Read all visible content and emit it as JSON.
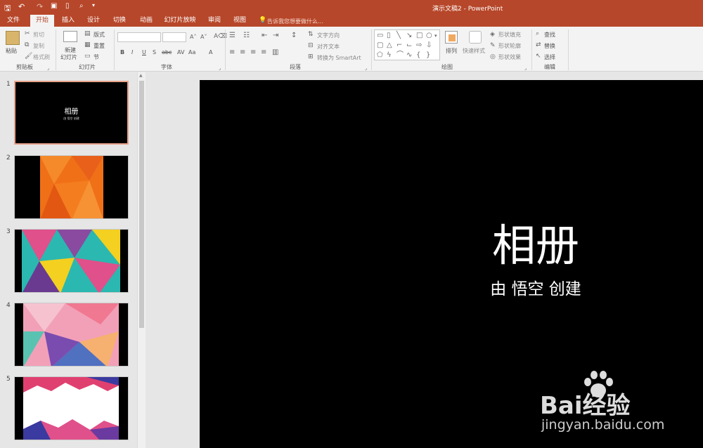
{
  "window": {
    "title": "演示文稿2 - PowerPoint",
    "qat": [
      "save-icon",
      "undo-icon",
      "redo-icon",
      "start-slideshow-icon",
      "new-icon",
      "customize-icon"
    ]
  },
  "tabs": [
    "文件",
    "开始",
    "插入",
    "设计",
    "切换",
    "动画",
    "幻灯片放映",
    "审阅",
    "视图"
  ],
  "tell_me": "告诉我您想要做什么...",
  "ribbon": {
    "clipboard": {
      "paste": "粘贴",
      "cut": "剪切",
      "copy": "复制",
      "format_painter": "格式刷",
      "group": "剪贴板"
    },
    "slides": {
      "new_slide": "新建",
      "new_slide2": "幻灯片",
      "layout": "版式",
      "reset": "重置",
      "section": "节",
      "group": "幻灯片"
    },
    "font": {
      "bold": "B",
      "italic": "I",
      "underline": "U",
      "strike": "S",
      "spacing": "abc",
      "case": "Aa",
      "color": "A",
      "group": "字体"
    },
    "paragraph": {
      "text_direction": "文字方向",
      "align_text": "对齐文本",
      "smartart": "转换为 SmartArt",
      "group": "段落"
    },
    "drawing": {
      "arrange": "排列",
      "quick_styles": "快速样式",
      "shape_fill": "形状填充",
      "shape_outline": "形状轮廓",
      "shape_effects": "形状效果",
      "group": "绘图"
    },
    "editing": {
      "find": "查找",
      "replace": "替换",
      "select": "选择",
      "group": "编辑"
    }
  },
  "thumbnails": [
    {
      "num": "1",
      "title": "相册",
      "subtitle": "由 悟空 创建"
    },
    {
      "num": "2"
    },
    {
      "num": "3"
    },
    {
      "num": "4"
    },
    {
      "num": "5"
    }
  ],
  "slide": {
    "title": "相册",
    "subtitle": "由 悟空 创建"
  },
  "watermark": {
    "brand": "Bai经验",
    "url": "jingyan.baidu.com"
  },
  "colors": {
    "accent": "#b7472a",
    "ribbon": "#f3f3f3",
    "slide": "#000000"
  }
}
